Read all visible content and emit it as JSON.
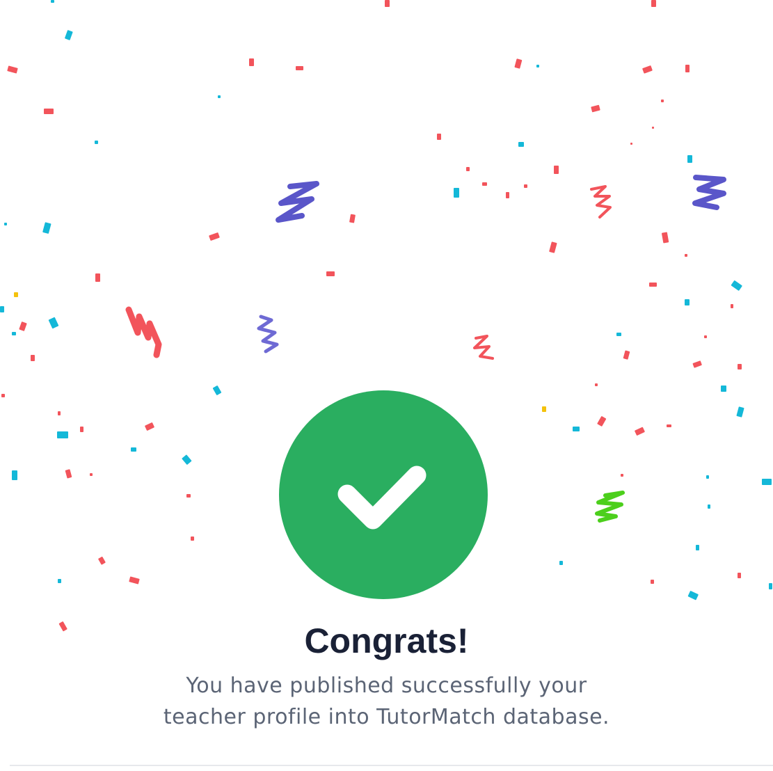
{
  "colors": {
    "success": "#2aae60",
    "title": "#1a2136",
    "message": "#5b6475",
    "confetti_red": "#f2545b",
    "confetti_cyan": "#14b8d8",
    "confetti_purple": "#5a56c9",
    "confetti_green": "#4ccf1c",
    "confetti_yellow": "#f4c20d"
  },
  "icons": {
    "status": "checkmark-icon"
  },
  "dialog": {
    "title": "Congrats!",
    "message_line1": "You have published successfully your",
    "message_line2": "teacher profile into TutorMatch database."
  }
}
